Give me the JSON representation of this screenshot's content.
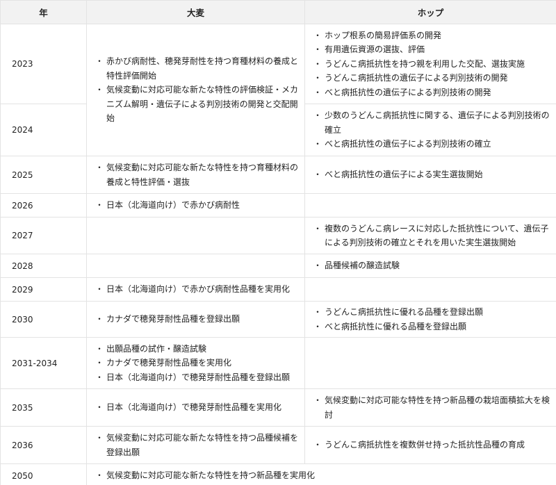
{
  "headers": {
    "year": "年",
    "barley": "大麦",
    "hop": "ホップ"
  },
  "rows": [
    {
      "year": "2023",
      "barley": [
        "赤かび病耐性、穂発芽耐性を持つ育種材料の養成と特性評価開始",
        "気候変動に対応可能な新たな特性の評価検証・メカニズム解明・遺伝子による判別技術の開発と交配開始"
      ],
      "hop": [
        "ホップ根系の簡易評価系の開発",
        "有用遺伝資源の選抜、評価",
        "うどんこ病抵抗性を持つ親を利用した交配、選抜実施",
        "うどんこ病抵抗性の遺伝子による判別技術の開発",
        "べと病抵抗性の遺伝子による判別技術の開発"
      ]
    },
    {
      "year": "2024",
      "hop": [
        "少数のうどんこ病抵抗性に関する、遺伝子による判別技術の確立",
        "べと病抵抗性の遺伝子による判別技術の確立"
      ]
    },
    {
      "year": "2025",
      "barley": [
        "気候変動に対応可能な新たな特性を持つ育種材料の養成と特性評価・選抜"
      ],
      "hop": [
        "べと病抵抗性の遺伝子による実生選抜開始"
      ]
    },
    {
      "year": "2026",
      "barley": [
        "日本（北海道向け）で赤かび病耐性"
      ],
      "hop": []
    },
    {
      "year": "2027",
      "barley": [],
      "hop": [
        "複数のうどんこ病レースに対応した抵抗性について、遺伝子による判別技術の確立とそれを用いた実生選抜開始"
      ]
    },
    {
      "year": "2028",
      "barley": [],
      "hop": [
        "品種候補の醸造試験"
      ]
    },
    {
      "year": "2029",
      "barley": [
        "日本（北海道向け）で赤かび病耐性品種を実用化"
      ],
      "hop": []
    },
    {
      "year": "2030",
      "barley": [
        "カナダで穂発芽耐性品種を登録出願"
      ],
      "hop": [
        "うどんこ病抵抗性に優れる品種を登録出願",
        "べと病抵抗性に優れる品種を登録出願"
      ]
    },
    {
      "year": "2031-2034",
      "barley": [
        "出願品種の試作・醸造試験",
        "カナダで穂発芽耐性品種を実用化",
        "日本（北海道向け）で穂発芽耐性品種を登録出願"
      ],
      "hop": []
    },
    {
      "year": "2035",
      "barley": [
        "日本（北海道向け）で穂発芽耐性品種を実用化"
      ],
      "hop": [
        "気候変動に対応可能な特性を持つ新品種の栽培面積拡大を検討"
      ]
    },
    {
      "year": "2036",
      "barley": [
        "気候変動に対応可能な新たな特性を持つ品種候補を登録出願"
      ],
      "hop": [
        "うどんこ病抵抗性を複数併せ持った抵抗性品種の育成"
      ]
    },
    {
      "year": "2050",
      "both": [
        "気候変動に対応可能な新たな特性を持つ新品種を実用化"
      ]
    }
  ]
}
